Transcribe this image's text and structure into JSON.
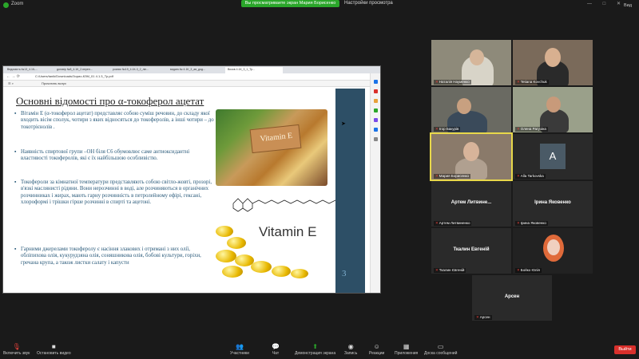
{
  "app": {
    "title": "Zoom",
    "view_banner": "Вы просматриваете экран Мария Борисенко",
    "view_settings": "Настройки просмотра",
    "view_label": "Вид",
    "win_controls": "— □ ✕"
  },
  "browser": {
    "tabs": [
      "Ведомість №13_4.1К-...",
      "договір №8_4.1К_2.переп...",
      "розпис №19_4.1К-3_2_лін...",
      "видатк.№ 4.1К_3_ав_дод...",
      "Визов 4.1К_3_1_Тр..."
    ],
    "active_tab": "Визов 4.1К_3_1_Тр...",
    "address": "C:/Users/tanik/Downloads/Зорио-КЗМ_01 4.1.3_Тр.pdf",
    "page_indicator": "Прочитать вслух"
  },
  "slide": {
    "title": "Основні відомості про α-токоферол ацетат",
    "bullets": [
      "Вітамін Е (α-токоферол ацетат) представляє собою суміш речовин, до складу якої входить вісім сполук, чотири з яких відносяться до токоферолів, а інші чотири – до токотрієнолів .",
      "Наявність спиртової групи –ОН біля C6 обумовлює саме антиоксидантні властивості токоферолів, які є їх найбільшою особливістю.",
      "Токофероли за кімнатної температури представляють собою світло-жовті, прозорі, в'язкі маслянисті рідини. Вони нерозчинні в воді, але розчиняються в органічних розчинниках і жирах, мають гарну розчинність в петролейному ефірі, гексані, хлороформі і трішки гірше розчинні в спирті та ацетоні.",
      "Гарними джерелами токоферолу є насіння злакових і отримані з них олії, обліпихова олія, кукурудзяна олія, соняшникова олія, бобові культури, горіхи, гречана крупа, а також листки салату і капусти"
    ],
    "board_text": "Vitamin E",
    "image_label": "Vitamin E",
    "page_number": "3"
  },
  "gallery": [
    {
      "name": "Наталія Науменко",
      "type": "video"
    },
    {
      "name": "Tetiana Kovchuk",
      "type": "video"
    },
    {
      "name": "Ігор Бакурів",
      "type": "video"
    },
    {
      "name": "Олена Рагузіна",
      "type": "video"
    },
    {
      "name": "Мария Борисенко",
      "type": "video"
    },
    {
      "name": "Alla Tarkovska",
      "type": "avatar",
      "initial": "A"
    },
    {
      "name": "Артем Литвиненко",
      "center": "Артем Литвине...",
      "type": "name"
    },
    {
      "name": "Ірина Яковенко",
      "center": "Ірина Яковенко",
      "type": "name"
    },
    {
      "name": "Ткалин Євгеній",
      "center": "Ткалин Евгеній",
      "type": "name"
    },
    {
      "name": "Бойко Юлія",
      "type": "video"
    },
    {
      "name": "Арсен",
      "center": "Арсен",
      "type": "name"
    }
  ],
  "toolbar": {
    "mute": "Включить звук",
    "video": "Остановить видео",
    "participants": "Участники",
    "participants_count": "11",
    "chat": "Чат",
    "share": "Демонстрация экрана",
    "record": "Запись",
    "reactions": "Реакции",
    "apps": "Приложения",
    "notes": "Доска сообщений",
    "end": "Выйти"
  },
  "colors": {
    "zoom_green": "#2aa62a",
    "end_red": "#d9302c",
    "slide_accent": "#2d4f66",
    "active_speaker": "#e8d84a"
  }
}
